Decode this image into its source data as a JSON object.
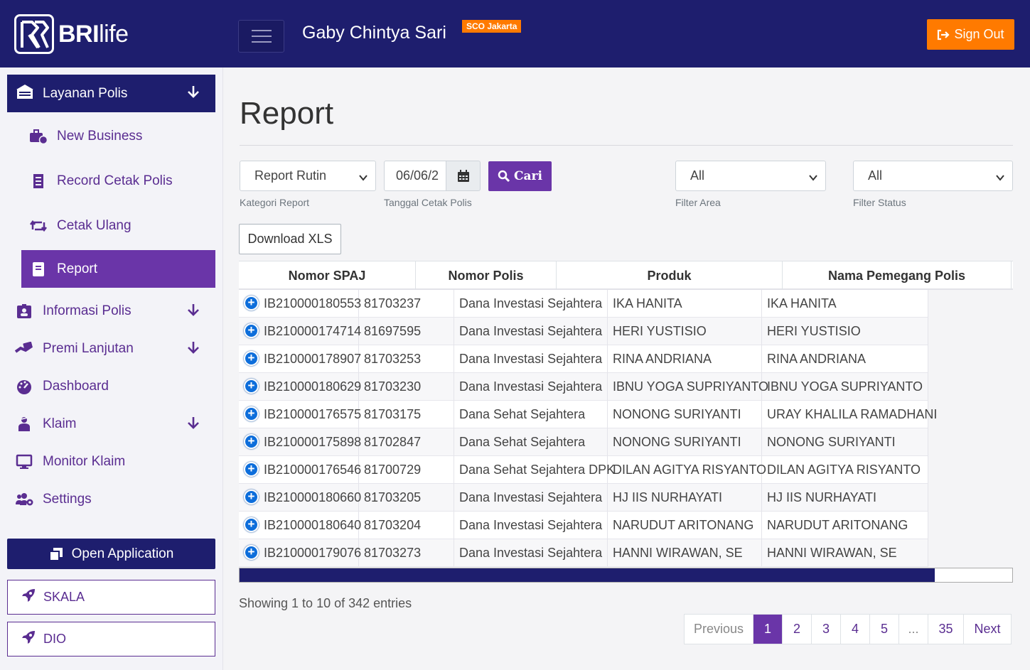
{
  "header": {
    "logo_bold": "BRI",
    "logo_light": "life",
    "user_name": "Gaby Chintya Sari",
    "location_badge": "SCO Jakarta",
    "signout_label": "Sign Out"
  },
  "sidebar": {
    "main": {
      "label": "Layanan Polis",
      "icon": "building-icon"
    },
    "subitems": [
      {
        "label": "New Business",
        "icon": "briefcase-clock-icon"
      },
      {
        "label": "Record Cetak Polis",
        "icon": "receipt-icon"
      },
      {
        "label": "Cetak Ulang",
        "icon": "retweet-icon"
      },
      {
        "label": "Report",
        "icon": "book-icon",
        "active": true
      }
    ],
    "items": [
      {
        "label": "Informasi Polis",
        "icon": "id-badge-icon",
        "expandable": true
      },
      {
        "label": "Premi Lanjutan",
        "icon": "hand-money-icon",
        "expandable": true
      },
      {
        "label": "Dashboard",
        "icon": "gauge-icon",
        "expandable": false
      },
      {
        "label": "Klaim",
        "icon": "user-injured-icon",
        "expandable": true
      },
      {
        "label": "Monitor Klaim",
        "icon": "desktop-icon",
        "expandable": false
      },
      {
        "label": "Settings",
        "icon": "users-cog-icon",
        "expandable": false
      }
    ],
    "open_application_label": "Open Application",
    "skala_label": "SKALA",
    "dio_label": "DIO"
  },
  "main": {
    "title": "Report",
    "filters": {
      "kategori_value": "Report Rutin",
      "kategori_hint": "Kategori Report",
      "tanggal_value": "06/06/2",
      "tanggal_hint": "Tanggal Cetak Polis",
      "cari_label": "Cari",
      "area_value": "All",
      "area_hint": "Filter Area",
      "status_value": "All",
      "status_hint": "Filter Status"
    },
    "download_label": "Download XLS",
    "table": {
      "headers": [
        "Nomor SPAJ",
        "Nomor Polis",
        "Produk",
        "Nama Pemegang Polis"
      ],
      "rows": [
        [
          "IB210000180553",
          "81703237",
          "Dana Investasi Sejahtera",
          "IKA HANITA",
          "IKA HANITA"
        ],
        [
          "IB210000174714",
          "81697595",
          "Dana Investasi Sejahtera",
          "HERI YUSTISIO",
          "HERI YUSTISIO"
        ],
        [
          "IB210000178907",
          "81703253",
          "Dana Investasi Sejahtera",
          "RINA ANDRIANA",
          "RINA ANDRIANA"
        ],
        [
          "IB210000180629",
          "81703230",
          "Dana Investasi Sejahtera",
          "IBNU YOGA SUPRIYANTO",
          "IBNU YOGA SUPRIYANTO"
        ],
        [
          "IB210000176575",
          "81703175",
          "Dana Sehat Sejahtera",
          "NONONG SURIYANTI",
          "URAY KHALILA RAMADHANI"
        ],
        [
          "IB210000175898",
          "81702847",
          "Dana Sehat Sejahtera",
          "NONONG SURIYANTI",
          "NONONG SURIYANTI"
        ],
        [
          "IB210000176546",
          "81700729",
          "Dana Sehat Sejahtera DPK",
          "DILAN AGITYA RISYANTO",
          "DILAN AGITYA RISYANTO"
        ],
        [
          "IB210000180660",
          "81703205",
          "Dana Investasi Sejahtera",
          "HJ IIS NURHAYATI",
          "HJ IIS NURHAYATI"
        ],
        [
          "IB210000180640",
          "81703204",
          "Dana Investasi Sejahtera",
          "NARUDUT ARITONANG",
          "NARUDUT ARITONANG"
        ],
        [
          "IB210000179076",
          "81703273",
          "Dana Investasi Sejahtera",
          "HANNI WIRAWAN, SE",
          "HANNI WIRAWAN, SE"
        ]
      ],
      "scroll_fraction": 0.9
    },
    "showing_text": "Showing 1 to 10 of 342 entries",
    "pagination": [
      "Previous",
      "1",
      "2",
      "3",
      "4",
      "5",
      "...",
      "35",
      "Next"
    ],
    "pagination_active": "1"
  },
  "colors": {
    "navy": "#1e1e6e",
    "purple": "#6a35a8",
    "orange": "#ff7a00",
    "link_purple": "#5a2d91"
  }
}
